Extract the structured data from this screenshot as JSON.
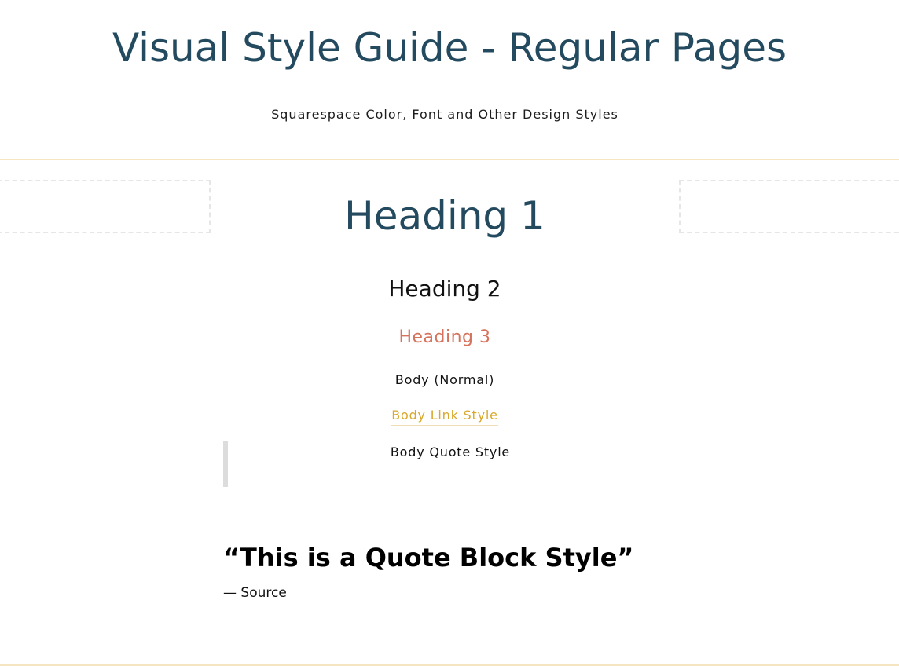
{
  "header": {
    "title": "Visual Style Guide - Regular Pages",
    "subtitle": "Squarespace Color, Font and Other Design Styles"
  },
  "styles": {
    "heading1": "Heading 1",
    "heading2": "Heading 2",
    "heading3": "Heading 3",
    "body_normal": "Body (Normal)",
    "body_link": "Body Link Style",
    "body_quote": "Body Quote Style"
  },
  "quote_block": {
    "text": "“This is a Quote Block Style”",
    "source": "— Source"
  },
  "colors": {
    "heading_blue": "#234a5f",
    "heading3_coral": "#d6735d",
    "link_gold": "#d9a92d",
    "divider": "#f5e6c1",
    "quote_bar": "#dcdcdc"
  }
}
